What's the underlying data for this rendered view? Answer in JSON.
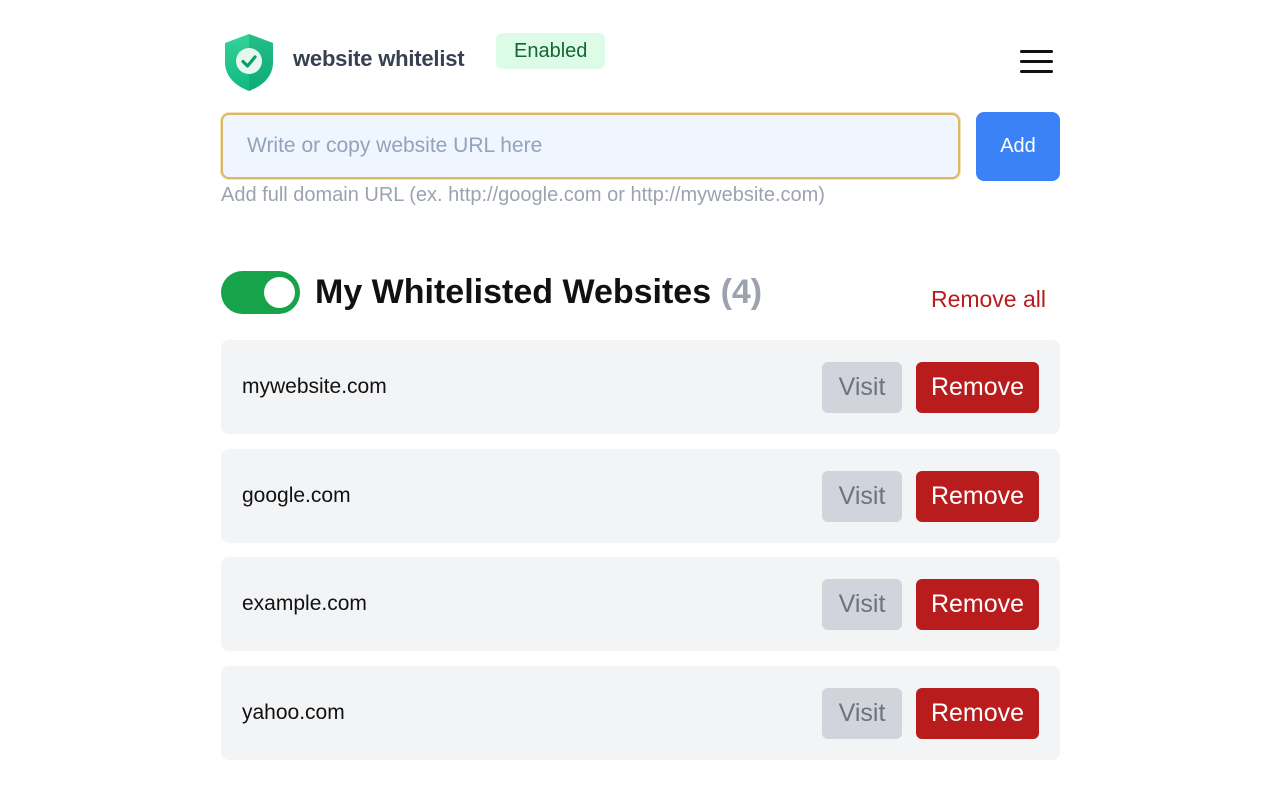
{
  "header": {
    "title": "website whitelist",
    "status": "Enabled",
    "logo_icon": "shield-check-icon",
    "menu_icon": "hamburger-menu-icon"
  },
  "add_form": {
    "placeholder": "Write or copy website URL here",
    "value": "",
    "add_label": "Add",
    "hint": "Add full domain URL (ex. http://google.com or http://mywebsite.com)"
  },
  "whitelist": {
    "enabled": true,
    "title": "My Whitelisted Websites",
    "count": "(4)",
    "remove_all_label": "Remove all",
    "visit_label": "Visit",
    "remove_label": "Remove",
    "sites": [
      {
        "name": "mywebsite.com"
      },
      {
        "name": "google.com"
      },
      {
        "name": "example.com"
      },
      {
        "name": "yahoo.com"
      }
    ]
  },
  "colors": {
    "accent_blue": "#3b82f6",
    "danger_red": "#b91c1c",
    "toggle_green": "#16a34a",
    "badge_bg": "#dcfce7",
    "badge_text": "#166534",
    "row_bg": "#f3f4f6"
  }
}
